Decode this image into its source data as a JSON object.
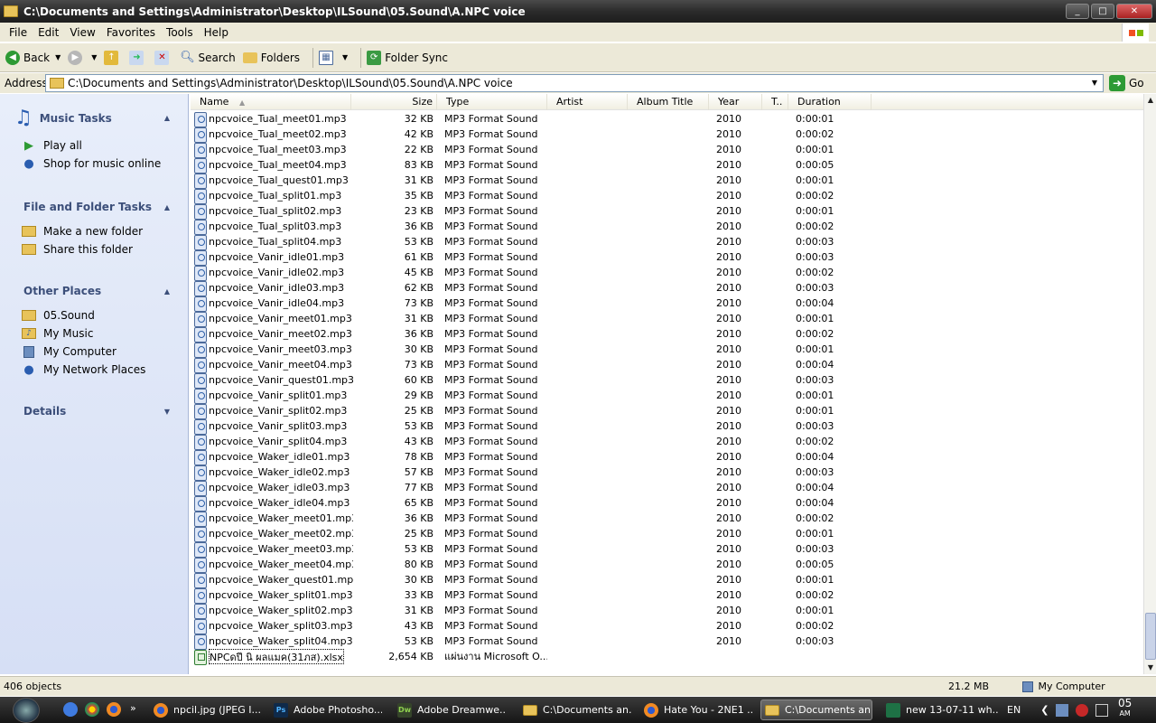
{
  "window": {
    "title": "C:\\Documents and Settings\\Administrator\\Desktop\\ILSound\\05.Sound\\A.NPC voice",
    "min_glyph": "_",
    "max_glyph": "□",
    "close_glyph": "✕"
  },
  "menu": [
    "File",
    "Edit",
    "View",
    "Favorites",
    "Tools",
    "Help"
  ],
  "toolbar": {
    "back_label": "Back",
    "search_label": "Search",
    "folders_label": "Folders",
    "folder_sync_label": "Folder Sync"
  },
  "address": {
    "label": "Address",
    "value": "C:\\Documents and Settings\\Administrator\\Desktop\\ILSound\\05.Sound\\A.NPC voice",
    "go_label": "Go"
  },
  "taskpane": {
    "music_tasks": {
      "title": "Music Tasks",
      "items": [
        "Play all",
        "Shop for music online"
      ]
    },
    "file_folder_tasks": {
      "title": "File and Folder Tasks",
      "items": [
        "Make a new folder",
        "Share this folder"
      ]
    },
    "other_places": {
      "title": "Other Places",
      "items": [
        "05.Sound",
        "My Music",
        "My Computer",
        "My Network Places"
      ]
    },
    "details": {
      "title": "Details"
    }
  },
  "columns": [
    "Name",
    "Size",
    "Type",
    "Artist",
    "Album Title",
    "Year",
    "T..",
    "Duration"
  ],
  "files": [
    {
      "name": "npcvoice_Tual_meet01.mp3",
      "size": "32 KB",
      "type": "MP3 Format Sound",
      "year": "2010",
      "duration": "0:00:01"
    },
    {
      "name": "npcvoice_Tual_meet02.mp3",
      "size": "42 KB",
      "type": "MP3 Format Sound",
      "year": "2010",
      "duration": "0:00:02"
    },
    {
      "name": "npcvoice_Tual_meet03.mp3",
      "size": "22 KB",
      "type": "MP3 Format Sound",
      "year": "2010",
      "duration": "0:00:01"
    },
    {
      "name": "npcvoice_Tual_meet04.mp3",
      "size": "83 KB",
      "type": "MP3 Format Sound",
      "year": "2010",
      "duration": "0:00:05"
    },
    {
      "name": "npcvoice_Tual_quest01.mp3",
      "size": "31 KB",
      "type": "MP3 Format Sound",
      "year": "2010",
      "duration": "0:00:01"
    },
    {
      "name": "npcvoice_Tual_split01.mp3",
      "size": "35 KB",
      "type": "MP3 Format Sound",
      "year": "2010",
      "duration": "0:00:02"
    },
    {
      "name": "npcvoice_Tual_split02.mp3",
      "size": "23 KB",
      "type": "MP3 Format Sound",
      "year": "2010",
      "duration": "0:00:01"
    },
    {
      "name": "npcvoice_Tual_split03.mp3",
      "size": "36 KB",
      "type": "MP3 Format Sound",
      "year": "2010",
      "duration": "0:00:02"
    },
    {
      "name": "npcvoice_Tual_split04.mp3",
      "size": "53 KB",
      "type": "MP3 Format Sound",
      "year": "2010",
      "duration": "0:00:03"
    },
    {
      "name": "npcvoice_Vanir_idle01.mp3",
      "size": "61 KB",
      "type": "MP3 Format Sound",
      "year": "2010",
      "duration": "0:00:03"
    },
    {
      "name": "npcvoice_Vanir_idle02.mp3",
      "size": "45 KB",
      "type": "MP3 Format Sound",
      "year": "2010",
      "duration": "0:00:02"
    },
    {
      "name": "npcvoice_Vanir_idle03.mp3",
      "size": "62 KB",
      "type": "MP3 Format Sound",
      "year": "2010",
      "duration": "0:00:03"
    },
    {
      "name": "npcvoice_Vanir_idle04.mp3",
      "size": "73 KB",
      "type": "MP3 Format Sound",
      "year": "2010",
      "duration": "0:00:04"
    },
    {
      "name": "npcvoice_Vanir_meet01.mp3",
      "size": "31 KB",
      "type": "MP3 Format Sound",
      "year": "2010",
      "duration": "0:00:01"
    },
    {
      "name": "npcvoice_Vanir_meet02.mp3",
      "size": "36 KB",
      "type": "MP3 Format Sound",
      "year": "2010",
      "duration": "0:00:02"
    },
    {
      "name": "npcvoice_Vanir_meet03.mp3",
      "size": "30 KB",
      "type": "MP3 Format Sound",
      "year": "2010",
      "duration": "0:00:01"
    },
    {
      "name": "npcvoice_Vanir_meet04.mp3",
      "size": "73 KB",
      "type": "MP3 Format Sound",
      "year": "2010",
      "duration": "0:00:04"
    },
    {
      "name": "npcvoice_Vanir_quest01.mp3",
      "size": "60 KB",
      "type": "MP3 Format Sound",
      "year": "2010",
      "duration": "0:00:03"
    },
    {
      "name": "npcvoice_Vanir_split01.mp3",
      "size": "29 KB",
      "type": "MP3 Format Sound",
      "year": "2010",
      "duration": "0:00:01"
    },
    {
      "name": "npcvoice_Vanir_split02.mp3",
      "size": "25 KB",
      "type": "MP3 Format Sound",
      "year": "2010",
      "duration": "0:00:01"
    },
    {
      "name": "npcvoice_Vanir_split03.mp3",
      "size": "53 KB",
      "type": "MP3 Format Sound",
      "year": "2010",
      "duration": "0:00:03"
    },
    {
      "name": "npcvoice_Vanir_split04.mp3",
      "size": "43 KB",
      "type": "MP3 Format Sound",
      "year": "2010",
      "duration": "0:00:02"
    },
    {
      "name": "npcvoice_Waker_idle01.mp3",
      "size": "78 KB",
      "type": "MP3 Format Sound",
      "year": "2010",
      "duration": "0:00:04"
    },
    {
      "name": "npcvoice_Waker_idle02.mp3",
      "size": "57 KB",
      "type": "MP3 Format Sound",
      "year": "2010",
      "duration": "0:00:03"
    },
    {
      "name": "npcvoice_Waker_idle03.mp3",
      "size": "77 KB",
      "type": "MP3 Format Sound",
      "year": "2010",
      "duration": "0:00:04"
    },
    {
      "name": "npcvoice_Waker_idle04.mp3",
      "size": "65 KB",
      "type": "MP3 Format Sound",
      "year": "2010",
      "duration": "0:00:04"
    },
    {
      "name": "npcvoice_Waker_meet01.mp3",
      "size": "36 KB",
      "type": "MP3 Format Sound",
      "year": "2010",
      "duration": "0:00:02"
    },
    {
      "name": "npcvoice_Waker_meet02.mp3",
      "size": "25 KB",
      "type": "MP3 Format Sound",
      "year": "2010",
      "duration": "0:00:01"
    },
    {
      "name": "npcvoice_Waker_meet03.mp3",
      "size": "53 KB",
      "type": "MP3 Format Sound",
      "year": "2010",
      "duration": "0:00:03"
    },
    {
      "name": "npcvoice_Waker_meet04.mp3",
      "size": "80 KB",
      "type": "MP3 Format Sound",
      "year": "2010",
      "duration": "0:00:05"
    },
    {
      "name": "npcvoice_Waker_quest01.mp3",
      "size": "30 KB",
      "type": "MP3 Format Sound",
      "year": "2010",
      "duration": "0:00:01"
    },
    {
      "name": "npcvoice_Waker_split01.mp3",
      "size": "33 KB",
      "type": "MP3 Format Sound",
      "year": "2010",
      "duration": "0:00:02"
    },
    {
      "name": "npcvoice_Waker_split02.mp3",
      "size": "31 KB",
      "type": "MP3 Format Sound",
      "year": "2010",
      "duration": "0:00:01"
    },
    {
      "name": "npcvoice_Waker_split03.mp3",
      "size": "43 KB",
      "type": "MP3 Format Sound",
      "year": "2010",
      "duration": "0:00:02"
    },
    {
      "name": "npcvoice_Waker_split04.mp3",
      "size": "53 KB",
      "type": "MP3 Format Sound",
      "year": "2010",
      "duration": "0:00:03"
    },
    {
      "name": "NPCดปี นิ ผลแมค(31ภส).xlsx",
      "size": "2,654 KB",
      "type": "แผ่นงาน Microsoft O...",
      "year": "",
      "duration": "",
      "icon": "excel",
      "selected": true
    }
  ],
  "status": {
    "objects": "406 objects",
    "size": "21.2 MB",
    "location": "My Computer"
  },
  "taskbar": {
    "buttons": [
      {
        "label": "npcil.jpg (JPEG I...",
        "icon": "firefox"
      },
      {
        "label": "Adobe Photosho...",
        "icon": "Ps"
      },
      {
        "label": "Adobe Dreamwe...",
        "icon": "Dw"
      },
      {
        "label": "C:\\Documents an...",
        "icon": "folder"
      },
      {
        "label": "Hate You - 2NE1 ...",
        "icon": "firefox"
      },
      {
        "label": "C:\\Documents an...",
        "icon": "folder",
        "active": true
      },
      {
        "label": "new 13-07-11 wh...",
        "icon": "excel"
      }
    ],
    "lang": "EN",
    "clock_time": "05",
    "clock_ampm": "AM"
  },
  "colors": {
    "title_bar": "#2b2b2b",
    "task_pane_bg": "#dfe6f7",
    "task_header": "#3c4f7a",
    "chrome": "#ece9d8",
    "taskbar": "#1e1e1e"
  }
}
